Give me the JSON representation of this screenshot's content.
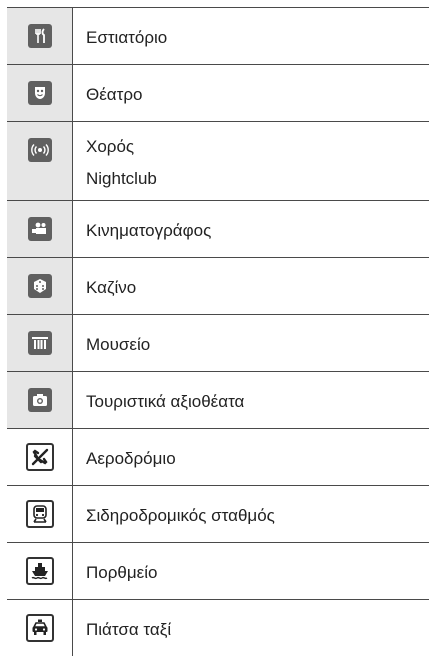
{
  "rows": [
    {
      "icon": "fork-knife-icon",
      "lines": [
        "Εστιατόριο"
      ]
    },
    {
      "icon": "theater-mask-icon",
      "lines": [
        "Θέατρο"
      ]
    },
    {
      "icon": "speaker-icon",
      "lines": [
        "Χορός",
        "Nightclub"
      ]
    },
    {
      "icon": "movie-camera-icon",
      "lines": [
        "Κινηματογράφος"
      ]
    },
    {
      "icon": "dice-icon",
      "lines": [
        "Καζίνο"
      ]
    },
    {
      "icon": "museum-column-icon",
      "lines": [
        "Μουσείο"
      ]
    },
    {
      "icon": "camera-icon",
      "lines": [
        "Τουριστικά αξιοθέατα"
      ]
    },
    {
      "icon": "airplane-icon",
      "lines": [
        "Αεροδρόμιο"
      ]
    },
    {
      "icon": "train-icon",
      "lines": [
        "Σιδηροδρομικός σταθμός"
      ]
    },
    {
      "icon": "ferry-icon",
      "lines": [
        "Πορθμείο"
      ]
    },
    {
      "icon": "taxi-icon",
      "lines": [
        "Πιάτσα ταξί"
      ]
    }
  ],
  "colors": {
    "border": "#4a4a4a",
    "icon_cell_bg": "#e6e6e6",
    "icon_fill": "#606060",
    "text": "#222222"
  }
}
